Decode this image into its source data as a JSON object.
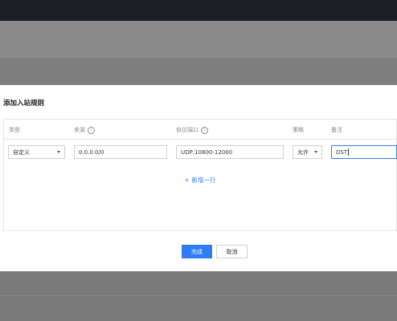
{
  "dialog": {
    "title": "添加入站规则",
    "headers": {
      "type": "类型",
      "source": "来源",
      "port": "协议端口",
      "policy": "策略",
      "remark": "备注"
    },
    "row": {
      "type_value": "自定义",
      "source_value": "0.0.0.0/0",
      "port_value": "UDP:10800-12000",
      "policy_value": "允许",
      "remark_value": "DST"
    },
    "add_row_label": "+ 新增一行",
    "confirm_label": "完成",
    "cancel_label": "取消"
  },
  "colors": {
    "primary": "#2f7df6",
    "topbar": "#1c1f26",
    "overlay": "#7d7d7d"
  },
  "icons": {
    "source_info": "info-icon",
    "port_info": "info-icon"
  }
}
